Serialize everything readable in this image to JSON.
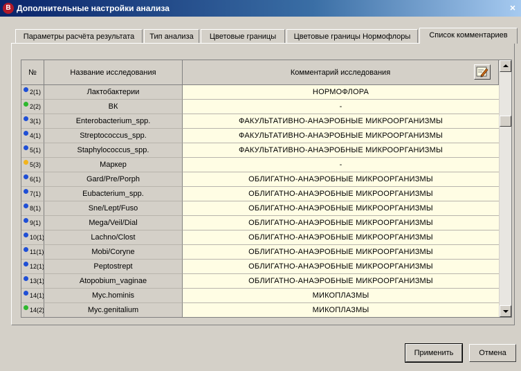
{
  "window": {
    "title": "Дополнительные настройки анализа",
    "icon_letter": "B",
    "close_glyph": "×"
  },
  "tabs": [
    {
      "label": "Параметры расчёта результата",
      "active": false
    },
    {
      "label": "Тип анализа",
      "active": false
    },
    {
      "label": "Цветовые границы",
      "active": false
    },
    {
      "label": "Цветовые границы Нормофлоры",
      "active": false
    },
    {
      "label": "Список комментариев",
      "active": true
    }
  ],
  "grid": {
    "columns": {
      "num": "№",
      "name": "Название исследования",
      "comment": "Комментарий исследования"
    },
    "edit_icon": "edit-comment-icon",
    "rows": [
      {
        "num": "2(1)",
        "name": "Лактобактерии",
        "comment": "НОРМОФЛОРА",
        "dot": "blue"
      },
      {
        "num": "2(2)",
        "name": "ВК",
        "comment": "-",
        "dot": "green"
      },
      {
        "num": "3(1)",
        "name": "Enterobacterium_spp.",
        "comment": "ФАКУЛЬТАТИВНО-АНАЭРОБНЫЕ МИКРООРГАНИЗМЫ",
        "dot": "blue"
      },
      {
        "num": "4(1)",
        "name": "Streptococcus_spp.",
        "comment": "ФАКУЛЬТАТИВНО-АНАЭРОБНЫЕ МИКРООРГАНИЗМЫ",
        "dot": "blue"
      },
      {
        "num": "5(1)",
        "name": "Staphylococcus_spp.",
        "comment": "ФАКУЛЬТАТИВНО-АНАЭРОБНЫЕ МИКРООРГАНИЗМЫ",
        "dot": "blue"
      },
      {
        "num": "5(3)",
        "name": "Маркер",
        "comment": "-",
        "dot": "yellow"
      },
      {
        "num": "6(1)",
        "name": "Gard/Pre/Porph",
        "comment": "ОБЛИГАТНО-АНАЭРОБНЫЕ МИКРООРГАНИЗМЫ",
        "dot": "blue"
      },
      {
        "num": "7(1)",
        "name": "Eubacterium_spp.",
        "comment": "ОБЛИГАТНО-АНАЭРОБНЫЕ МИКРООРГАНИЗМЫ",
        "dot": "blue"
      },
      {
        "num": "8(1)",
        "name": "Sne/Lept/Fuso",
        "comment": "ОБЛИГАТНО-АНАЭРОБНЫЕ МИКРООРГАНИЗМЫ",
        "dot": "blue"
      },
      {
        "num": "9(1)",
        "name": "Mega/Veil/Dial",
        "comment": "ОБЛИГАТНО-АНАЭРОБНЫЕ МИКРООРГАНИЗМЫ",
        "dot": "blue"
      },
      {
        "num": "10(1)",
        "name": "Lachno/Clost",
        "comment": "ОБЛИГАТНО-АНАЭРОБНЫЕ МИКРООРГАНИЗМЫ",
        "dot": "blue"
      },
      {
        "num": "11(1)",
        "name": "Mobi/Coryne",
        "comment": "ОБЛИГАТНО-АНАЭРОБНЫЕ МИКРООРГАНИЗМЫ",
        "dot": "blue"
      },
      {
        "num": "12(1)",
        "name": "Peptostrept",
        "comment": "ОБЛИГАТНО-АНАЭРОБНЫЕ МИКРООРГАНИЗМЫ",
        "dot": "blue"
      },
      {
        "num": "13(1)",
        "name": "Atopobium_vaginae",
        "comment": "ОБЛИГАТНО-АНАЭРОБНЫЕ МИКРООРГАНИЗМЫ",
        "dot": "blue"
      },
      {
        "num": "14(1)",
        "name": "Myc.hominis",
        "comment": "МИКОПЛАЗМЫ",
        "dot": "blue"
      },
      {
        "num": "14(2)",
        "name": "Myc.genitalium",
        "comment": "МИКОПЛАЗМЫ",
        "dot": "green"
      }
    ]
  },
  "dot_colors": {
    "blue": "#1f4fd6",
    "green": "#2eb82e",
    "yellow": "#f2b41c"
  },
  "buttons": {
    "apply": "Применить",
    "cancel": "Отмена"
  }
}
